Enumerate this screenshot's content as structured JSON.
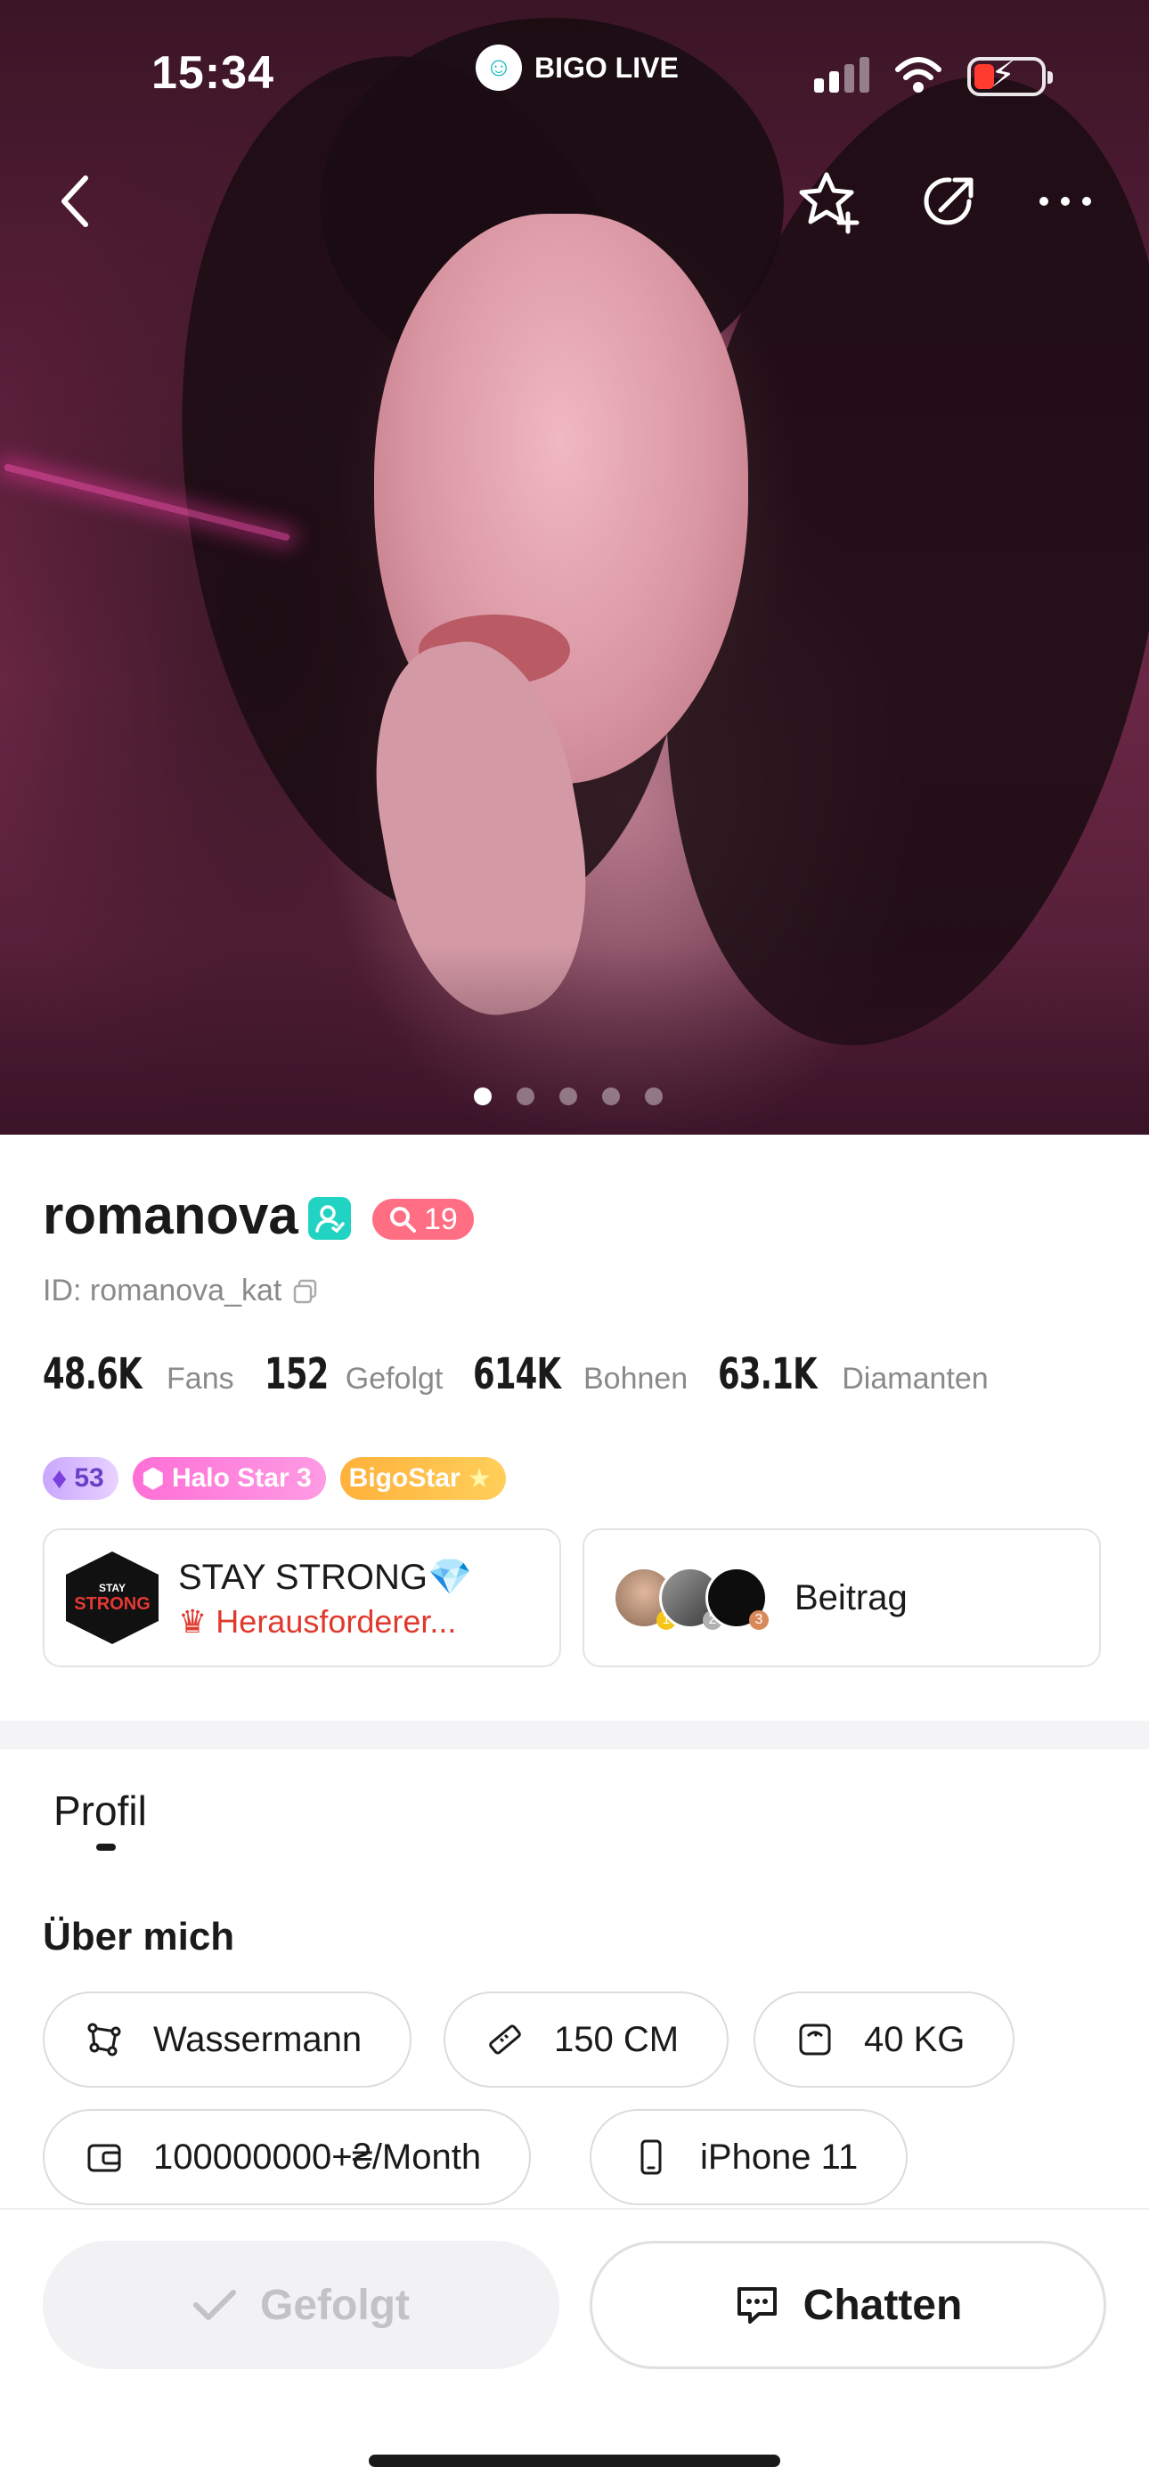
{
  "status_bar": {
    "time": "15:34",
    "app_name": "BIGO LIVE",
    "icons": [
      "signal-icon",
      "wifi-icon",
      "battery-charging-icon"
    ]
  },
  "top_actions": {
    "icons": [
      "back-icon",
      "star-add-icon",
      "share-icon",
      "more-icon"
    ]
  },
  "hero": {
    "pages": 5,
    "current_page": 1
  },
  "profile": {
    "username": "romanova",
    "level_badge": "19",
    "id_text": "ID: romanova_kat",
    "stats": [
      {
        "value": "48.6K",
        "label": "Fans"
      },
      {
        "value": "152",
        "label": "Gefolgt"
      },
      {
        "value": "614K",
        "label": "Bohnen"
      },
      {
        "value": "63.1K",
        "label": "Diamanten"
      }
    ],
    "chips": {
      "level": "53",
      "halo": "Halo Star 3",
      "bigostar": "BigoStar"
    }
  },
  "family_card": {
    "logo_top": "STAY",
    "logo_main": "STRONG",
    "title": "STAY STRONG💎",
    "subtitle": "Herausforderer..."
  },
  "contrib_card": {
    "label": "Beitrag",
    "ranks": [
      "1",
      "2",
      "3"
    ]
  },
  "tabs": [
    {
      "label": "Profil",
      "active": true
    }
  ],
  "about": {
    "heading": "Über mich",
    "tags": [
      {
        "icon": "zodiac-icon",
        "label": "Wassermann"
      },
      {
        "icon": "ruler-icon",
        "label": "150 CM"
      },
      {
        "icon": "scale-icon",
        "label": "40 KG"
      },
      {
        "icon": "wallet-icon",
        "label": "100000000+₴/Month"
      },
      {
        "icon": "phone-icon",
        "label": "iPhone 11"
      }
    ]
  },
  "bottom_bar": {
    "follow_label": "Gefolgt",
    "chat_label": "Chatten"
  }
}
